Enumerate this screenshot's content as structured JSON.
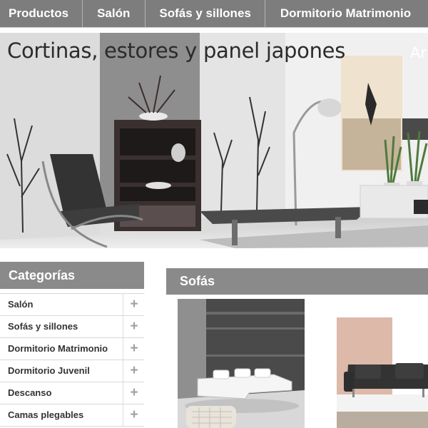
{
  "nav": {
    "items": [
      "Productos",
      "Salón",
      "Sofás y sillones",
      "Dormitorio Matrimonio"
    ]
  },
  "hero": {
    "title": "Cortinas, estores y panel japones",
    "brand": "Ar"
  },
  "sidebar": {
    "heading": "Categorías",
    "items": [
      {
        "label": "Salón",
        "icon": "plus-icon"
      },
      {
        "label": "Sofás y sillones",
        "icon": "plus-icon"
      },
      {
        "label": "Dormitorio Matrimonio",
        "icon": "plus-icon"
      },
      {
        "label": "Dormitorio Juvenil",
        "icon": "plus-icon"
      },
      {
        "label": "Descanso",
        "icon": "plus-icon"
      },
      {
        "label": "Camas plegables",
        "icon": "plus-icon"
      }
    ],
    "expand_symbol": "+"
  },
  "main": {
    "section_title": "Sofás"
  },
  "colors": {
    "nav_bg": "#7d7d7d",
    "heading_bg": "#8a8a8a",
    "text": "#333333"
  }
}
